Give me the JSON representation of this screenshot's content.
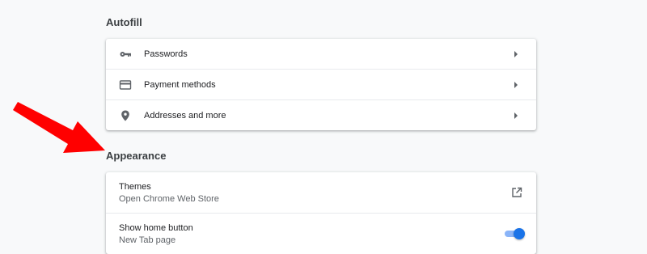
{
  "sections": {
    "autofill": {
      "title": "Autofill",
      "items": [
        {
          "label": "Passwords",
          "icon": "key-icon"
        },
        {
          "label": "Payment methods",
          "icon": "credit-card-icon"
        },
        {
          "label": "Addresses and more",
          "icon": "location-pin-icon"
        }
      ]
    },
    "appearance": {
      "title": "Appearance",
      "themes": {
        "title": "Themes",
        "subtitle": "Open Chrome Web Store",
        "icon": "open-external-icon"
      },
      "home_button": {
        "title": "Show home button",
        "subtitle": "New Tab page",
        "enabled": true
      }
    }
  },
  "colors": {
    "page_bg": "#f8f9fa",
    "accent": "#1a73e8",
    "annotation_arrow": "#ff0000"
  }
}
